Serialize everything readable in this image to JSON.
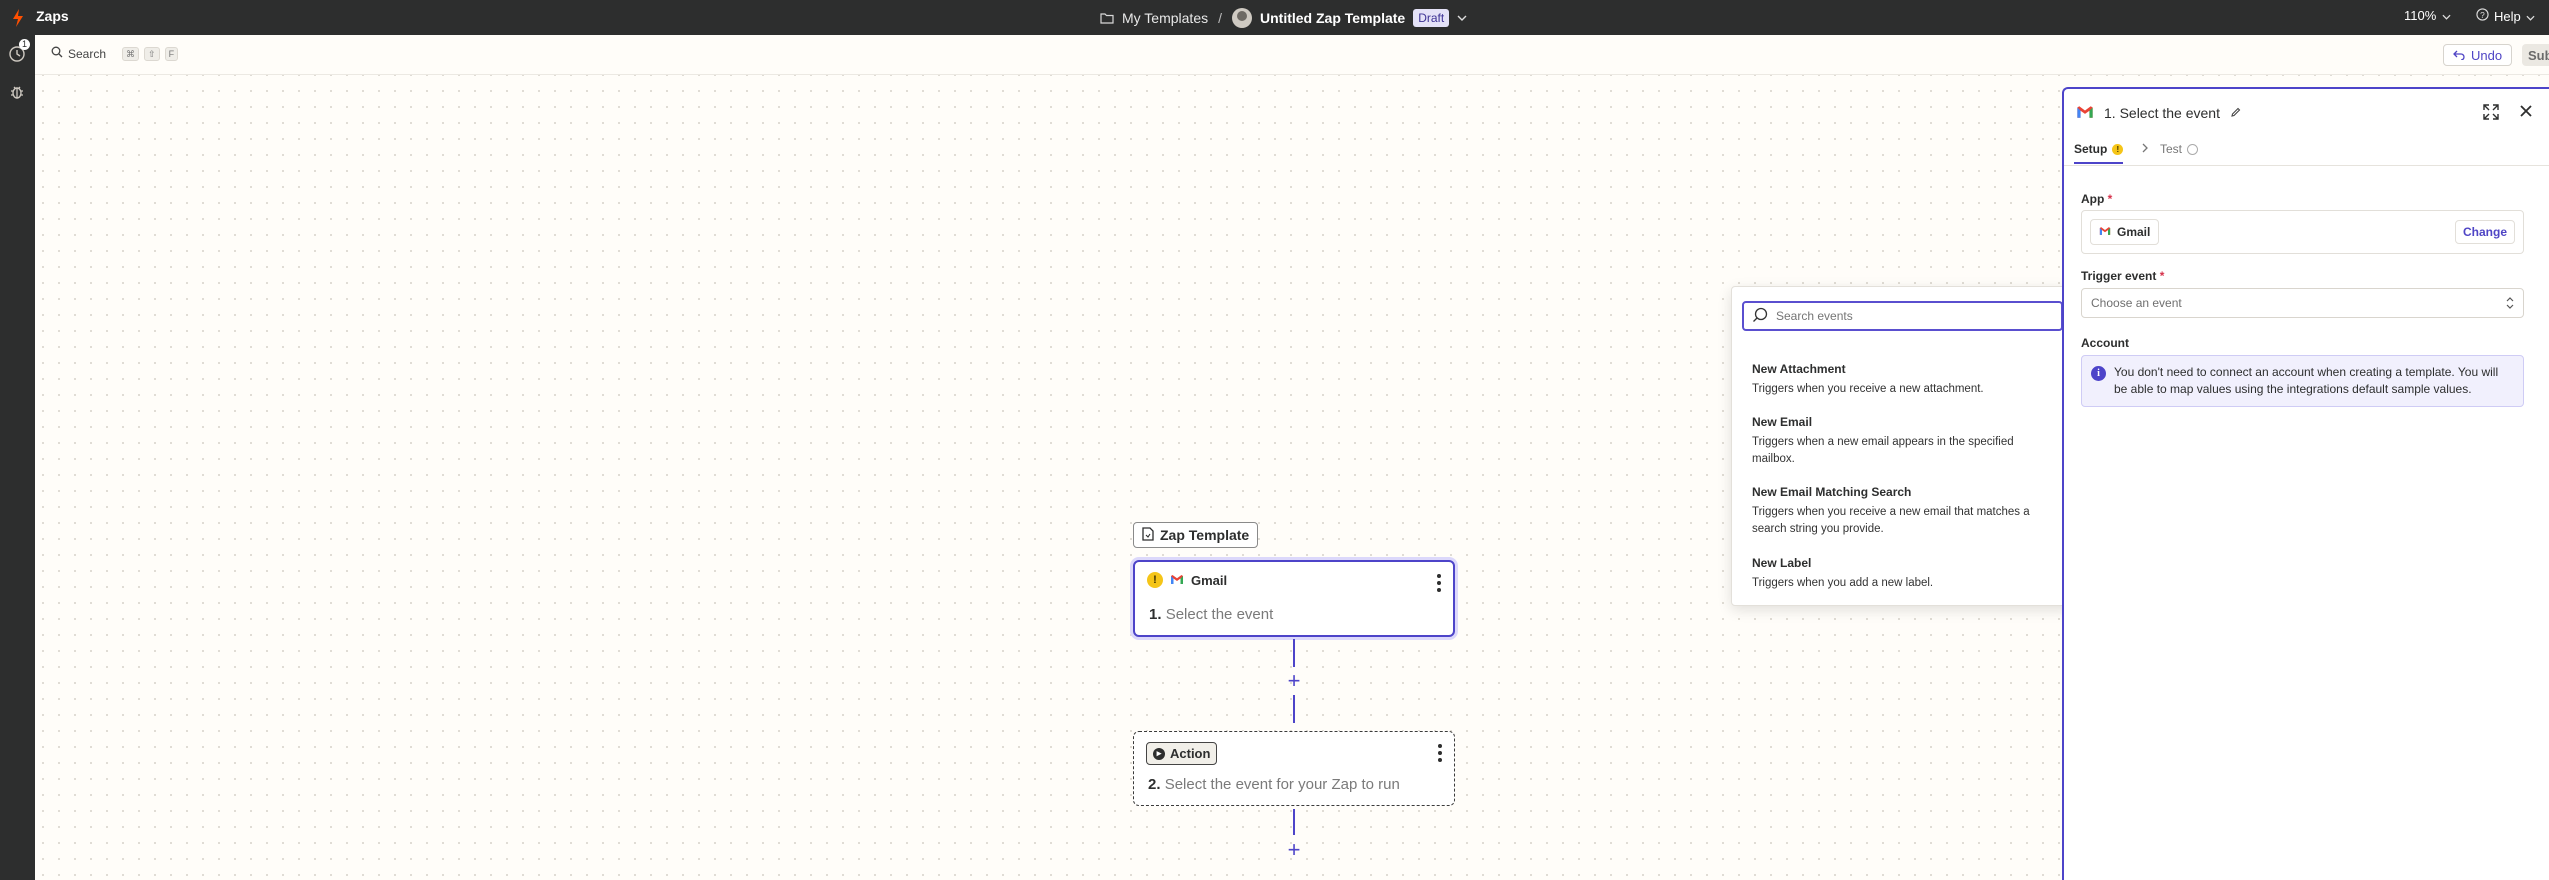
{
  "topbar": {
    "app_title": "Zaps",
    "breadcrumb_folder": "My Templates",
    "breadcrumb_sep": "/",
    "zap_name": "Untitled Zap Template",
    "status_badge": "Draft",
    "zoom": "110%",
    "help": "Help"
  },
  "rail": {
    "history_badge": "1"
  },
  "subbar": {
    "search_label": "Search",
    "shortcut_keys": [
      "⌘",
      "⇧",
      "F"
    ],
    "undo_label": "Undo",
    "submit_label": "Submit"
  },
  "canvas": {
    "template_tag": "Zap Template",
    "trigger": {
      "app": "Gmail",
      "step_number": "1.",
      "text": "Select the event"
    },
    "action": {
      "chip": "Action",
      "step_number": "2.",
      "text": "Select the event for your Zap to run"
    }
  },
  "dropdown": {
    "search_placeholder": "Search events",
    "events": [
      {
        "title": "New Attachment",
        "desc": "Triggers when you receive a new attachment."
      },
      {
        "title": "New Email",
        "desc": "Triggers when a new email appears in the specified mailbox."
      },
      {
        "title": "New Email Matching Search",
        "desc": "Triggers when you receive a new email that matches a search string you provide."
      },
      {
        "title": "New Label",
        "desc": "Triggers when you add a new label."
      }
    ]
  },
  "panel": {
    "title": "1. Select the event",
    "tabs": {
      "setup": "Setup",
      "test": "Test"
    },
    "app_label": "App",
    "required_mark": "*",
    "app_value": "Gmail",
    "change_button": "Change",
    "trigger_label": "Trigger event",
    "trigger_placeholder": "Choose an event",
    "account_label": "Account",
    "account_info": "You don't need to connect an account when creating a template. You will be able to map values using the integrations default sample values."
  },
  "colors": {
    "accent": "#4d44c9",
    "topbar": "#2d2e2e",
    "warning": "#f5c518",
    "zapier_orange": "#ff4f00"
  }
}
